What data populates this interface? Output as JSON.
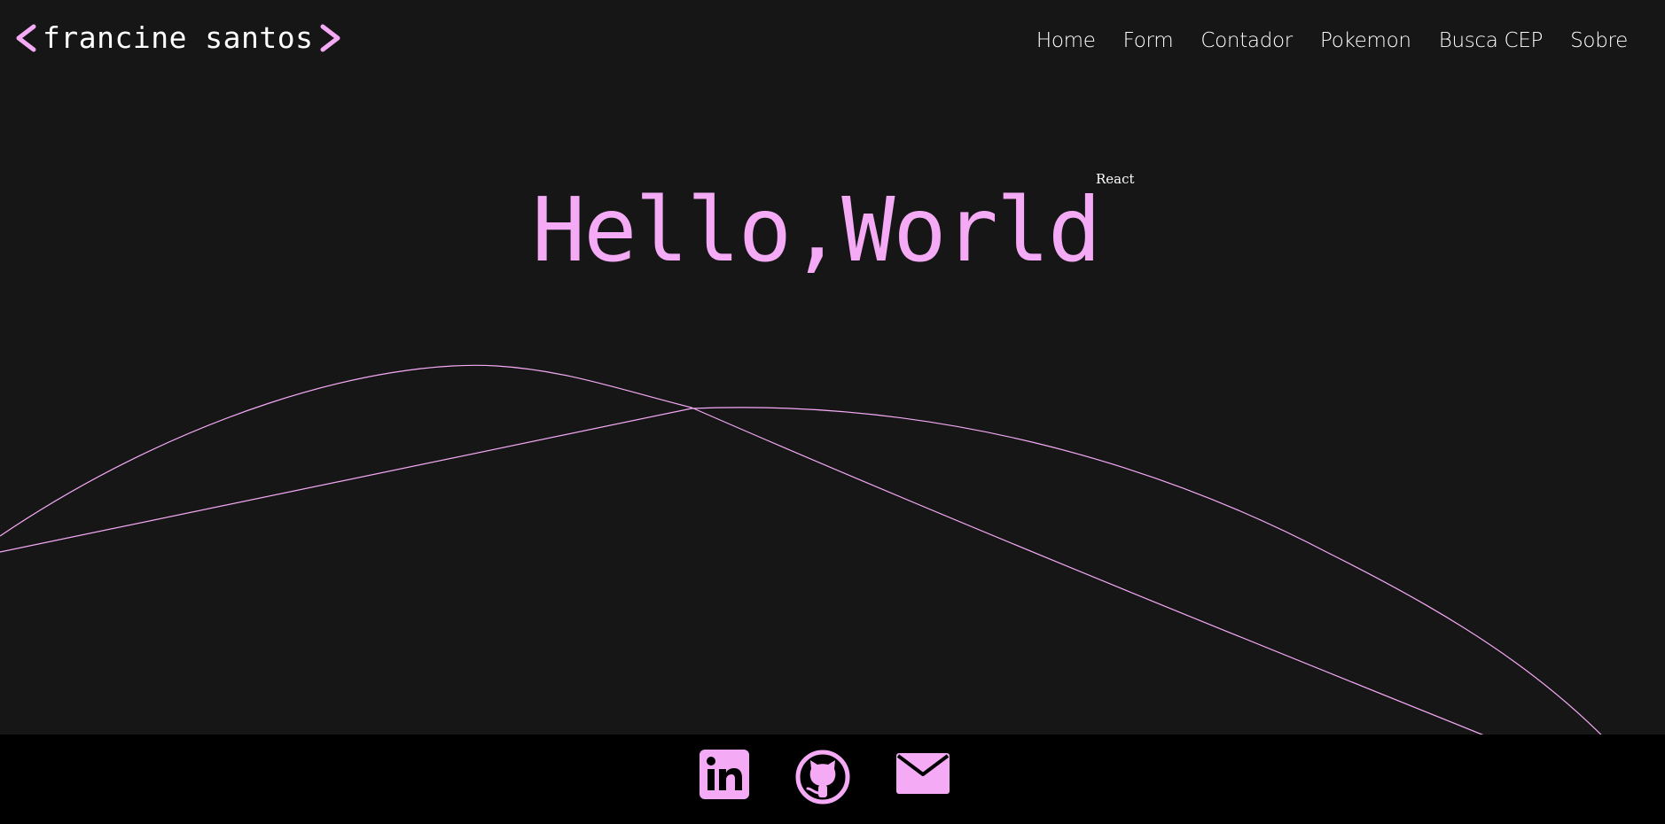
{
  "header": {
    "logo_text": "francine santos",
    "nav": [
      {
        "label": "Home"
      },
      {
        "label": "Form"
      },
      {
        "label": "Contador"
      },
      {
        "label": "Pokemon"
      },
      {
        "label": "Busca CEP"
      },
      {
        "label": "Sobre"
      }
    ]
  },
  "hero": {
    "title": "Hello,World",
    "badge": "React"
  },
  "footer": {
    "icons": [
      "linkedin-icon",
      "github-icon",
      "email-icon"
    ]
  },
  "colors": {
    "background": "#161616",
    "accent": "#f5aaf6",
    "footer": "#000000",
    "text": "#ffffff"
  }
}
